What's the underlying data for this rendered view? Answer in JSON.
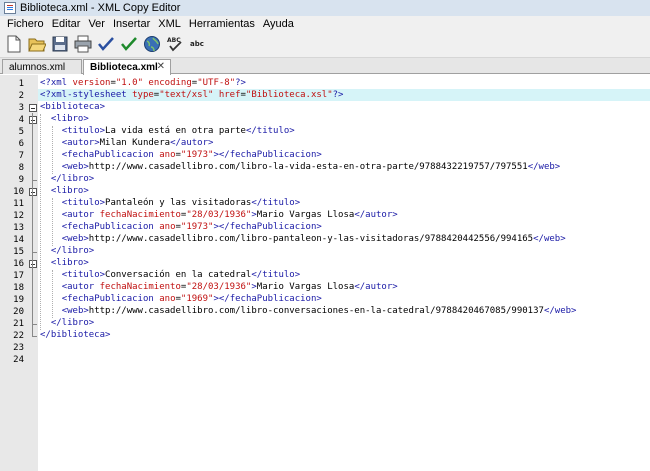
{
  "window": {
    "title": "Biblioteca.xml - XML Copy Editor"
  },
  "menu": [
    "Fichero",
    "Editar",
    "Ver",
    "Insertar",
    "XML",
    "Herramientas",
    "Ayuda"
  ],
  "toolbar": {
    "icons": [
      "new-document-icon",
      "open-folder-icon",
      "save-icon",
      "print-icon",
      "check-wellformed-icon",
      "validate-icon",
      "browser-preview-icon",
      "spellcheck-icon",
      "abc-check-icon"
    ],
    "spell_label": "ABC",
    "abc_label": "abc"
  },
  "tabs": [
    {
      "label": "alumnos.xml",
      "active": false
    },
    {
      "label": "Biblioteca.xml",
      "active": true,
      "close": "✕"
    }
  ],
  "editor": {
    "line_numbers": [
      "1",
      "2",
      "3",
      "4",
      "5",
      "6",
      "7",
      "8",
      "9",
      "10",
      "11",
      "12",
      "13",
      "14",
      "15",
      "16",
      "17",
      "18",
      "19",
      "20",
      "21",
      "22",
      "23",
      "24"
    ],
    "lines": [
      {
        "parts": [
          [
            "pi",
            "<?"
          ],
          [
            "t",
            "xml"
          ],
          [
            "a",
            " version"
          ],
          [
            "tx",
            "="
          ],
          [
            "v",
            "\"1.0\""
          ],
          [
            "a",
            " encoding"
          ],
          [
            "tx",
            "="
          ],
          [
            "v",
            "\"UTF-8\""
          ],
          [
            "pi",
            "?>"
          ]
        ]
      },
      {
        "parts": [
          [
            "pi",
            "<?"
          ],
          [
            "t",
            "xml-stylesheet"
          ],
          [
            "a",
            " type"
          ],
          [
            "tx",
            "="
          ],
          [
            "v",
            "\"text/xsl\""
          ],
          [
            "a",
            " href"
          ],
          [
            "tx",
            "="
          ],
          [
            "v",
            "\"Biblioteca.xsl\""
          ],
          [
            "pi",
            "?>"
          ]
        ]
      },
      {
        "parts": [
          [
            "t",
            "<biblioteca>"
          ]
        ]
      },
      {
        "parts": [
          [
            "tx",
            "  "
          ],
          [
            "t",
            "<libro>"
          ]
        ]
      },
      {
        "parts": [
          [
            "tx",
            "    "
          ],
          [
            "t",
            "<titulo>"
          ],
          [
            "tx",
            "La vida está en otra parte"
          ],
          [
            "t",
            "</titulo>"
          ]
        ]
      },
      {
        "parts": [
          [
            "tx",
            "    "
          ],
          [
            "t",
            "<autor>"
          ],
          [
            "tx",
            "Milan Kundera"
          ],
          [
            "t",
            "</autor>"
          ]
        ]
      },
      {
        "parts": [
          [
            "tx",
            "    "
          ],
          [
            "t",
            "<fechaPublicacion"
          ],
          [
            "a",
            " ano"
          ],
          [
            "tx",
            "="
          ],
          [
            "v",
            "\"1973\""
          ],
          [
            "t",
            "></fechaPublicacion>"
          ]
        ]
      },
      {
        "parts": [
          [
            "tx",
            "    "
          ],
          [
            "t",
            "<web>"
          ],
          [
            "tx",
            "http://www.casadellibro.com/libro-la-vida-esta-en-otra-parte/9788432219757/797551"
          ],
          [
            "t",
            "</web>"
          ]
        ]
      },
      {
        "parts": [
          [
            "tx",
            "  "
          ],
          [
            "t",
            "</libro>"
          ]
        ]
      },
      {
        "parts": [
          [
            "tx",
            "  "
          ],
          [
            "t",
            "<libro>"
          ]
        ]
      },
      {
        "parts": [
          [
            "tx",
            "    "
          ],
          [
            "t",
            "<titulo>"
          ],
          [
            "tx",
            "Pantaleón y las visitadoras"
          ],
          [
            "t",
            "</titulo>"
          ]
        ]
      },
      {
        "parts": [
          [
            "tx",
            "    "
          ],
          [
            "t",
            "<autor"
          ],
          [
            "a",
            " fechaNacimiento"
          ],
          [
            "tx",
            "="
          ],
          [
            "v",
            "\"28/03/1936\""
          ],
          [
            "t",
            ">"
          ],
          [
            "tx",
            "Mario Vargas Llosa"
          ],
          [
            "t",
            "</autor>"
          ]
        ]
      },
      {
        "parts": [
          [
            "tx",
            "    "
          ],
          [
            "t",
            "<fechaPublicacion"
          ],
          [
            "a",
            " ano"
          ],
          [
            "tx",
            "="
          ],
          [
            "v",
            "\"1973\""
          ],
          [
            "t",
            "></fechaPublicacion>"
          ]
        ]
      },
      {
        "parts": [
          [
            "tx",
            "    "
          ],
          [
            "t",
            "<web>"
          ],
          [
            "tx",
            "http://www.casadellibro.com/libro-pantaleon-y-las-visitadoras/9788420442556/994165"
          ],
          [
            "t",
            "</web>"
          ]
        ]
      },
      {
        "parts": [
          [
            "tx",
            "  "
          ],
          [
            "t",
            "</libro>"
          ]
        ]
      },
      {
        "parts": [
          [
            "tx",
            "  "
          ],
          [
            "t",
            "<libro>"
          ]
        ]
      },
      {
        "parts": [
          [
            "tx",
            "    "
          ],
          [
            "t",
            "<titulo>"
          ],
          [
            "tx",
            "Conversación en la catedral"
          ],
          [
            "t",
            "</titulo>"
          ]
        ]
      },
      {
        "parts": [
          [
            "tx",
            "    "
          ],
          [
            "t",
            "<autor"
          ],
          [
            "a",
            " fechaNacimiento"
          ],
          [
            "tx",
            "="
          ],
          [
            "v",
            "\"28/03/1936\""
          ],
          [
            "t",
            ">"
          ],
          [
            "tx",
            "Mario Vargas Llosa"
          ],
          [
            "t",
            "</autor>"
          ]
        ]
      },
      {
        "parts": [
          [
            "tx",
            "    "
          ],
          [
            "t",
            "<fechaPublicacion"
          ],
          [
            "a",
            " ano"
          ],
          [
            "tx",
            "="
          ],
          [
            "v",
            "\"1969\""
          ],
          [
            "t",
            "></fechaPublicacion>"
          ]
        ]
      },
      {
        "parts": [
          [
            "tx",
            "    "
          ],
          [
            "t",
            "<web>"
          ],
          [
            "tx",
            "http://www.casadellibro.com/libro-conversaciones-en-la-catedral/9788420467085/990137"
          ],
          [
            "t",
            "</web>"
          ]
        ]
      },
      {
        "parts": [
          [
            "tx",
            "  "
          ],
          [
            "t",
            "</libro>"
          ]
        ]
      },
      {
        "parts": [
          [
            "t",
            "</biblioteca>"
          ]
        ]
      },
      {
        "parts": []
      },
      {
        "parts": []
      }
    ],
    "highlighted_line": 2,
    "fold_markers": [
      3,
      4,
      10,
      16
    ]
  },
  "colors": {
    "tag": "#1a1aa6",
    "attribute": "#c01010",
    "highlight": "#d6f4f8"
  }
}
